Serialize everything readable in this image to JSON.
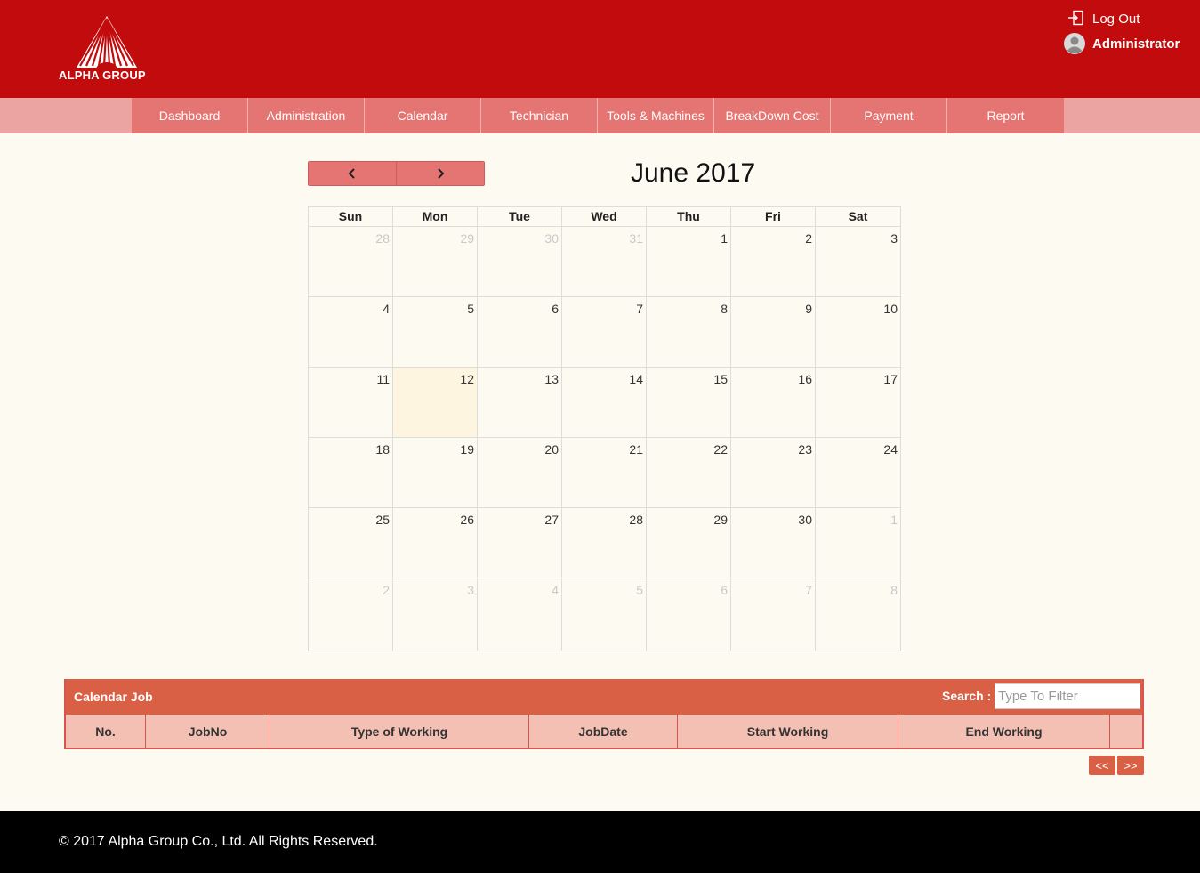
{
  "header": {
    "logo_text": "ALPHA GROUP",
    "logout_label": "Log Out",
    "user_name": "Administrator"
  },
  "nav": [
    "Dashboard",
    "Administration",
    "Calendar",
    "Technician",
    "Tools & Machines",
    "BreakDown Cost",
    "Payment",
    "Report"
  ],
  "calendar": {
    "title": "June 2017",
    "prev_icon": "chevron-left-icon",
    "next_icon": "chevron-right-icon",
    "weekdays": [
      "Sun",
      "Mon",
      "Tue",
      "Wed",
      "Thu",
      "Fri",
      "Sat"
    ],
    "weeks": [
      [
        "28",
        "29",
        "30",
        "31",
        "1",
        "2",
        "3"
      ],
      [
        "4",
        "5",
        "6",
        "7",
        "8",
        "9",
        "10"
      ],
      [
        "11",
        "12",
        "13",
        "14",
        "15",
        "16",
        "17"
      ],
      [
        "18",
        "19",
        "20",
        "21",
        "22",
        "23",
        "24"
      ],
      [
        "25",
        "26",
        "27",
        "28",
        "29",
        "30",
        "1"
      ],
      [
        "2",
        "3",
        "4",
        "5",
        "6",
        "7",
        "8"
      ]
    ],
    "today": "12"
  },
  "job_panel": {
    "title": "Calendar Job",
    "search_label": "Search :",
    "search_placeholder": "Type To Filter",
    "columns": [
      "No.",
      "JobNo",
      "Type of Working",
      "JobDate",
      "Start Working",
      "End Working",
      ""
    ],
    "pager_prev": "<<",
    "pager_next": ">>"
  },
  "footer": {
    "copyright": "© 2017 Alpha Group Co., Ltd. All Rights Reserved."
  },
  "colors": {
    "header_bg": "#c20b0c",
    "nav_bg": "#e57572",
    "panel_head": "#d95f45",
    "table_head": "#f4c0b3",
    "today_bg": "#fdf5e0"
  }
}
